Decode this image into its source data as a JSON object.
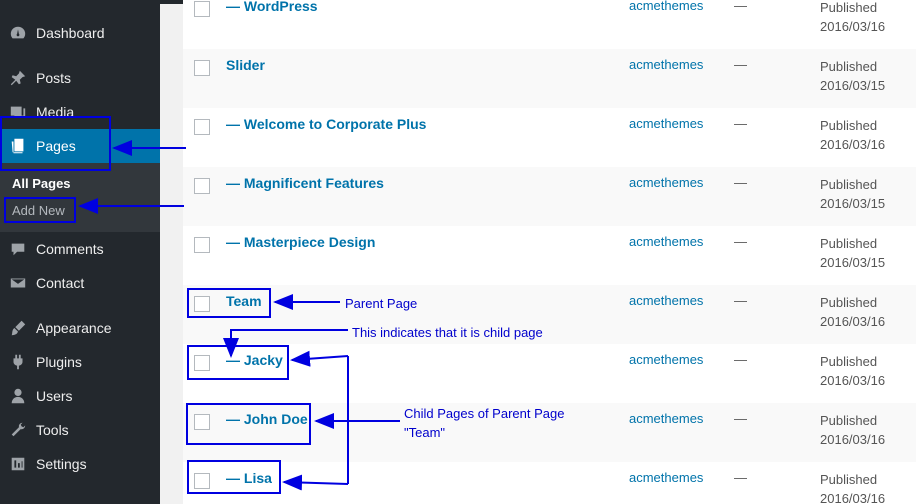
{
  "sidebar": {
    "items": [
      {
        "label": "Dashboard",
        "icon": "dashboard-icon"
      },
      {
        "label": "Posts",
        "icon": "pin-icon"
      },
      {
        "label": "Media",
        "icon": "media-icon"
      },
      {
        "label": "Pages",
        "icon": "pages-icon",
        "active": true
      },
      {
        "label": "Comments",
        "icon": "comment-icon"
      },
      {
        "label": "Contact",
        "icon": "mail-icon"
      },
      {
        "label": "Appearance",
        "icon": "brush-icon"
      },
      {
        "label": "Plugins",
        "icon": "plugin-icon"
      },
      {
        "label": "Users",
        "icon": "user-icon"
      },
      {
        "label": "Tools",
        "icon": "wrench-icon"
      },
      {
        "label": "Settings",
        "icon": "settings-icon"
      }
    ],
    "submenu": [
      {
        "label": "All Pages"
      },
      {
        "label": "Add New"
      }
    ]
  },
  "rows": [
    {
      "title": "— WordPress",
      "author": "acmethemes",
      "dash": "—",
      "status": "Published",
      "date": "2016/03/16"
    },
    {
      "title": "Slider",
      "author": "acmethemes",
      "dash": "—",
      "status": "Published",
      "date": "2016/03/15"
    },
    {
      "title": "— Welcome to Corporate Plus",
      "author": "acmethemes",
      "dash": "—",
      "status": "Published",
      "date": "2016/03/16"
    },
    {
      "title": "— Magnificent Features",
      "author": "acmethemes",
      "dash": "—",
      "status": "Published",
      "date": "2016/03/15"
    },
    {
      "title": "— Masterpiece Design",
      "author": "acmethemes",
      "dash": "—",
      "status": "Published",
      "date": "2016/03/15"
    },
    {
      "title": "Team",
      "author": "acmethemes",
      "dash": "—",
      "status": "Published",
      "date": "2016/03/16"
    },
    {
      "title": "— Jacky",
      "author": "acmethemes",
      "dash": "—",
      "status": "Published",
      "date": "2016/03/16"
    },
    {
      "title": "— John Doe",
      "author": "acmethemes",
      "dash": "—",
      "status": "Published",
      "date": "2016/03/16"
    },
    {
      "title": "— Lisa",
      "author": "acmethemes",
      "dash": "—",
      "status": "Published",
      "date": "2016/03/16"
    }
  ],
  "annotations": {
    "parent_page": "Parent Page",
    "child_indicator": "This indicates that it is child page",
    "child_pages_line1": "Child Pages of Parent Page",
    "child_pages_line2": "\"Team\""
  },
  "colors": {
    "sidebar_bg": "#23282d",
    "active_bg": "#0073aa",
    "link": "#0073aa",
    "annotation": "#0000e0"
  }
}
